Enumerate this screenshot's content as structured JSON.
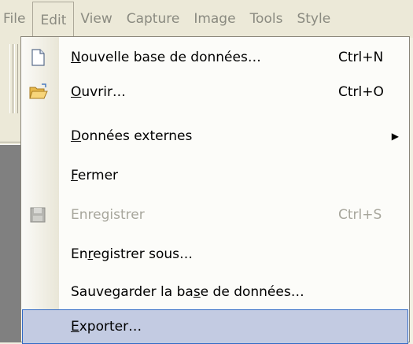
{
  "menubar": {
    "items": [
      "File",
      "Edit",
      "View",
      "Capture",
      "Image",
      "Tools",
      "Style"
    ]
  },
  "menu": {
    "items": [
      {
        "pre": "",
        "u": "N",
        "post": "ouvelle base de données…",
        "shortcut": "Ctrl+N",
        "icon": "new-document-icon"
      },
      {
        "pre": "",
        "u": "O",
        "post": "uvrir…",
        "shortcut": "Ctrl+O",
        "icon": "open-folder-icon"
      },
      {
        "pre": "",
        "u": "D",
        "post": "onnées externes",
        "shortcut": "",
        "submenu": true
      },
      {
        "pre": "",
        "u": "F",
        "post": "ermer",
        "shortcut": ""
      },
      {
        "pre": "Enre",
        "u": "g",
        "post": "istrer",
        "shortcut": "Ctrl+S",
        "icon": "save-disk-icon",
        "disabled": true
      },
      {
        "pre": "En",
        "u": "r",
        "post": "egistrer sous…",
        "shortcut": ""
      },
      {
        "pre": "Sauvegarder la ba",
        "u": "s",
        "post": "e de données…",
        "shortcut": ""
      },
      {
        "pre": "",
        "u": "E",
        "post": "xporter…",
        "shortcut": "",
        "selected": true
      }
    ]
  },
  "colors": {
    "selection_bg": "#c3cbe2",
    "selection_border": "#316ac5",
    "disabled_text": "#a7a69c",
    "menubar_text": "#8a8a80"
  }
}
